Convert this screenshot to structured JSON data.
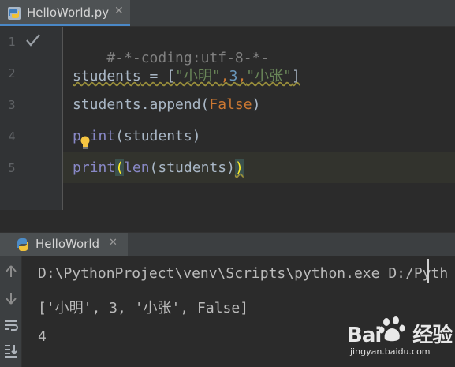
{
  "editor_tab": {
    "title": "HelloWorld.py",
    "close": "✕"
  },
  "editor": {
    "line_numbers": [
      "1",
      "2",
      "3",
      "4",
      "5"
    ],
    "code": {
      "line1": "#-*-coding:utf-8-*-",
      "line2": {
        "var": "students",
        "op": " = [",
        "s1": "\"小明\"",
        "c1": ",",
        "n": "3",
        "c2": ",",
        "s2": "\"小张\"",
        "end": "]"
      },
      "line3": {
        "head": "students.append(",
        "kw": "False",
        "end": ")"
      },
      "line4": {
        "p": "p",
        "hidden": "r",
        "rest": "int",
        "args": "(students)"
      },
      "line5": {
        "fn": "print",
        "open": "(",
        "inner_fn": "len",
        "args": "(students)",
        "close": ")"
      }
    }
  },
  "run_panel": {
    "tab_title": "HelloWorld",
    "close": "✕",
    "output": [
      "D:\\PythonProject\\venv\\Scripts\\python.exe D:/Pyth",
      "['小明', 3, '小张', False]",
      "4"
    ]
  },
  "watermark": {
    "logo_left": "Bai",
    "logo_right": "经验",
    "url": "jingyan.baidu.com"
  },
  "colors": {
    "background": "#2b2b2b",
    "comment": "#808080",
    "string": "#6a8759",
    "number": "#6897bb",
    "keyword": "#cc7832",
    "builtin": "#8888c6",
    "tab_underline": "#4a88c7"
  },
  "icons": [
    "python-file-icon",
    "checkmark-icon",
    "lightbulb-icon",
    "python-run-icon",
    "rerun-icon",
    "stop-icon",
    "soft-wrap-icon",
    "scroll-to-end-icon"
  ]
}
